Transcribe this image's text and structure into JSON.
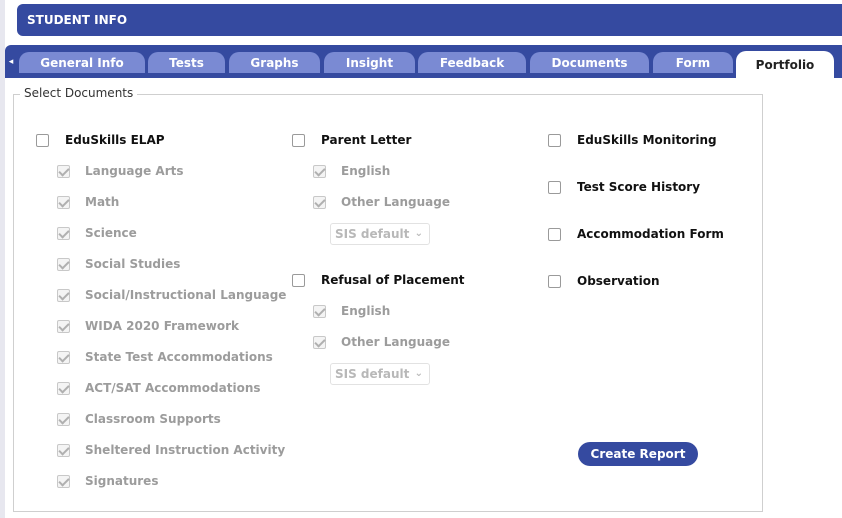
{
  "header": {
    "title": "STUDENT INFO"
  },
  "tabs": {
    "scroll_left": "◂",
    "items": [
      {
        "label": "General Info"
      },
      {
        "label": "Tests"
      },
      {
        "label": "Graphs"
      },
      {
        "label": "Insight"
      },
      {
        "label": "Feedback"
      },
      {
        "label": "Documents"
      },
      {
        "label": "Form"
      },
      {
        "label": "Portfolio",
        "active": true
      }
    ]
  },
  "select_documents": {
    "legend": "Select Documents",
    "col1": {
      "main": {
        "label": "EduSkills ELAP",
        "checked": false
      },
      "subs": [
        {
          "label": "Language Arts",
          "checked": true,
          "disabled": true
        },
        {
          "label": "Math",
          "checked": true,
          "disabled": true
        },
        {
          "label": "Science",
          "checked": true,
          "disabled": true
        },
        {
          "label": "Social Studies",
          "checked": true,
          "disabled": true
        },
        {
          "label": "Social/Instructional Language",
          "checked": true,
          "disabled": true
        },
        {
          "label": "WIDA 2020 Framework",
          "checked": true,
          "disabled": true
        },
        {
          "label": "State Test Accommodations",
          "checked": true,
          "disabled": true
        },
        {
          "label": "ACT/SAT Accommodations",
          "checked": true,
          "disabled": true
        },
        {
          "label": "Classroom Supports",
          "checked": true,
          "disabled": true
        },
        {
          "label": "Sheltered Instruction Activity",
          "checked": true,
          "disabled": true
        },
        {
          "label": "Signatures",
          "checked": true,
          "disabled": true
        }
      ]
    },
    "col2": {
      "parent_letter": {
        "label": "Parent Letter",
        "checked": false,
        "subs": [
          {
            "label": "English",
            "checked": true,
            "disabled": true
          },
          {
            "label": "Other Language",
            "checked": true,
            "disabled": true
          }
        ],
        "select_value": "SIS default"
      },
      "refusal": {
        "label": "Refusal of Placement",
        "checked": false,
        "subs": [
          {
            "label": "English",
            "checked": true,
            "disabled": true
          },
          {
            "label": "Other Language",
            "checked": true,
            "disabled": true
          }
        ],
        "select_value": "SIS default"
      }
    },
    "col3": [
      {
        "label": "EduSkills Monitoring",
        "checked": false
      },
      {
        "label": "Test Score History",
        "checked": false
      },
      {
        "label": "Accommodation Form",
        "checked": false
      },
      {
        "label": "Observation",
        "checked": false
      }
    ]
  },
  "actions": {
    "create_report": "Create Report"
  },
  "colors": {
    "primary": "#354aa0",
    "tab_inactive": "#7a8ad3",
    "disabled_text": "#9c9c9c"
  }
}
